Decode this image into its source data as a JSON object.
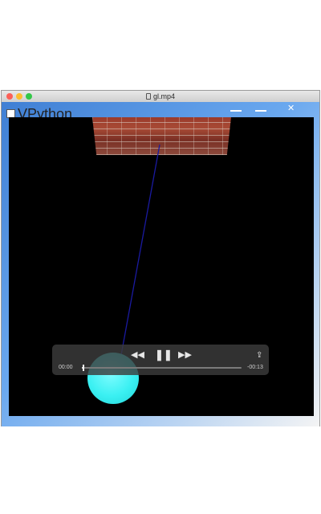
{
  "window": {
    "title": "gl.mp4"
  },
  "background_app": {
    "title": "VPython",
    "close_glyph": "✕"
  },
  "scene": {
    "ball_color": "#3af0f2",
    "string_color": "#1a1aa0"
  },
  "player": {
    "current_time": "00:00",
    "remaining_time": "-00:13",
    "progress": 0.01,
    "icons": {
      "rewind": "◀◀",
      "pause": "❚❚",
      "fast_forward": "▶▶",
      "share": "⇪"
    }
  }
}
